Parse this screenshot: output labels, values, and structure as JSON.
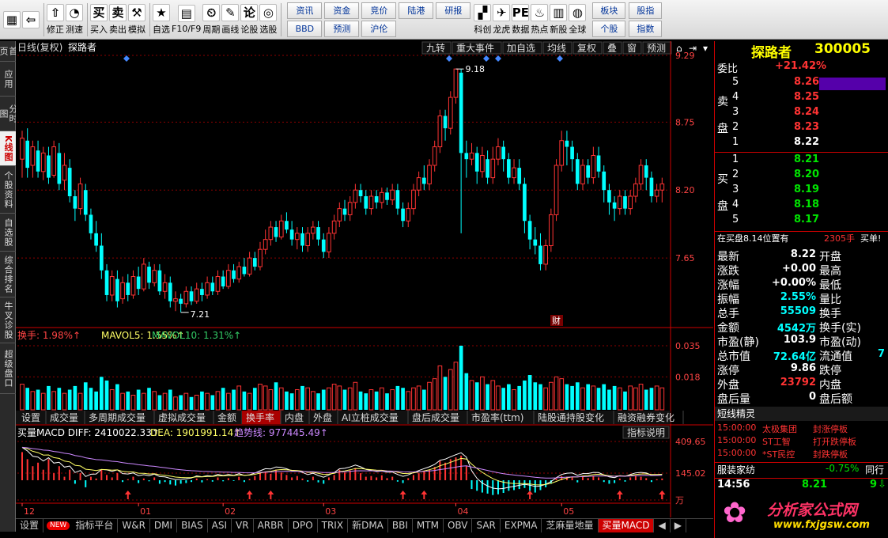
{
  "toolbar": {
    "buttons": [
      {
        "label": "",
        "icon": "win-logo-icon",
        "glyph": "▦"
      },
      {
        "label": "",
        "icon": "back-arrow-icon",
        "glyph": "⇦"
      },
      {
        "label": "修正",
        "icon": "up-arrow-icon",
        "glyph": "⇧"
      },
      {
        "label": "测速",
        "icon": "speed-icon",
        "glyph": "◔"
      },
      {
        "label": "买入",
        "icon": "buy-icon",
        "glyph": "买"
      },
      {
        "label": "卖出",
        "icon": "sell-icon",
        "glyph": "卖"
      },
      {
        "label": "模拟",
        "icon": "hammer-icon",
        "glyph": "⚒"
      },
      {
        "label": "自选",
        "icon": "star-icon",
        "glyph": "★"
      },
      {
        "label": "F10/F9",
        "icon": "f10-icon",
        "glyph": "▤"
      },
      {
        "label": "周期",
        "icon": "period-icon",
        "glyph": "⏲"
      },
      {
        "label": "画线",
        "icon": "pencil-icon",
        "glyph": "✎"
      },
      {
        "label": "论股",
        "icon": "discuss-icon",
        "glyph": "论"
      },
      {
        "label": "选股",
        "icon": "select-icon",
        "glyph": "◎"
      }
    ],
    "grid": [
      "资讯",
      "资金",
      "竞价",
      "陆港",
      "研报",
      "BBD",
      "预测",
      "沪伦"
    ],
    "buttons2": [
      {
        "label": "科创",
        "icon": "star-market-icon",
        "glyph": "▞"
      },
      {
        "label": "龙虎",
        "icon": "dragon-icon",
        "glyph": "✈"
      },
      {
        "label": "数据",
        "icon": "pe-icon",
        "glyph": "PE"
      },
      {
        "label": "热点",
        "icon": "hot-icon",
        "glyph": "♨"
      },
      {
        "label": "新股",
        "icon": "ipo-icon",
        "glyph": "▥"
      },
      {
        "label": "全球",
        "icon": "globe-icon",
        "glyph": "◍"
      }
    ],
    "grid2": [
      "板块",
      "股指",
      "个股",
      "指数"
    ]
  },
  "sidetabs": [
    "首页",
    "应用",
    "分时图",
    "K线图",
    "个股资料",
    "自选股",
    "综合排名",
    "牛叉诊股",
    "超级盘口"
  ],
  "chart_header": {
    "title": "日线(复权)",
    "stock": "探路者"
  },
  "chart_tools": [
    "九转",
    "重大事件",
    "加自选",
    "均线",
    "复权",
    "叠",
    "窗",
    "预测"
  ],
  "price_axis": [
    "9.29",
    "8.75",
    "8.20",
    "7.65"
  ],
  "annotations": {
    "high": "9.18",
    "low": "7.21",
    "cai": "财"
  },
  "vol_header": {
    "a": "换手: 1.98%↑",
    "b": "MAVOL5: 1.55%↑",
    "c": "MAVOL10: 1.31%↑"
  },
  "vol_axis": [
    "0.035",
    "0.018"
  ],
  "vol_tabs": [
    "设置",
    "成交量",
    "多周期成交量",
    "虚拟成交量",
    "金额",
    "换手率",
    "内盘",
    "外盘",
    "AI立桩成交量",
    "盘后成交量",
    "市盈率(ttm)",
    "陆股通持股变化",
    "融资融券变化"
  ],
  "macd_header": {
    "a": "买量MACD DIFF: 2410022.33↑",
    "b": "DEA: 1901991.14↑",
    "c": "趋势线: 977445.49↑",
    "btn": "指标说明"
  },
  "macd_axis": [
    "409.65",
    "145.02",
    "万"
  ],
  "months": [
    "12",
    "01",
    "02",
    "03",
    "04",
    "05"
  ],
  "bottom_tabs": [
    "设置",
    "NEW",
    "指标平台",
    "W&R",
    "DMI",
    "BIAS",
    "ASI",
    "VR",
    "ARBR",
    "DPO",
    "TRIX",
    "新DMA",
    "BBI",
    "MTM",
    "OBV",
    "SAR",
    "EXPMA",
    "芝麻量地量",
    "买量MACD"
  ],
  "quote": {
    "name": "探路者",
    "code": "300005",
    "webi_label": "委比",
    "webi": "+21.42%",
    "sell_label": "卖盘",
    "buy_label": "买盘",
    "asks": [
      {
        "n": "5",
        "p": "8.26"
      },
      {
        "n": "4",
        "p": "8.25"
      },
      {
        "n": "3",
        "p": "8.24"
      },
      {
        "n": "2",
        "p": "8.23"
      },
      {
        "n": "1",
        "p": "8.22"
      }
    ],
    "bids": [
      {
        "n": "1",
        "p": "8.21"
      },
      {
        "n": "2",
        "p": "8.20"
      },
      {
        "n": "3",
        "p": "8.19"
      },
      {
        "n": "4",
        "p": "8.18"
      },
      {
        "n": "5",
        "p": "8.17"
      }
    ],
    "buyline": {
      "a": "在买盘8.14位置有",
      "b": "2305手",
      "c": "买单!"
    },
    "stats": [
      [
        "最新",
        "8.22",
        "开盘",
        ""
      ],
      [
        "涨跌",
        "+0.00",
        "最高",
        ""
      ],
      [
        "涨幅",
        "+0.00%",
        "最低",
        ""
      ],
      [
        "振幅",
        "2.55%",
        "量比",
        ""
      ],
      [
        "总手",
        "55509",
        "换手",
        ""
      ],
      [
        "金额",
        "4542万",
        "换手(实)",
        ""
      ],
      [
        "市盈(静)",
        "103.9",
        "市盈(动)",
        ""
      ],
      [
        "总市值",
        "72.64亿",
        "流通值",
        "7"
      ],
      [
        "涨停",
        "9.86",
        "跌停",
        ""
      ],
      [
        "外盘",
        "23792",
        "内盘",
        ""
      ],
      [
        "盘后量",
        "0",
        "盘后额",
        ""
      ]
    ],
    "short_title": "短线精灵",
    "short": [
      [
        "15:00:00",
        "太极集团",
        "封涨停板"
      ],
      [
        "15:00:00",
        "ST工智",
        "打开跌停板"
      ],
      [
        "15:00:00",
        "*ST民控",
        "封跌停板"
      ]
    ],
    "sector": {
      "name": "服装家纺",
      "chg": "-0.75%",
      "tab": "同行"
    },
    "tick": {
      "time": "14:56",
      "price": "8.21",
      "vol": "9"
    },
    "logo": {
      "a": "分析家公式网",
      "b": "www.fxjgsw.com"
    }
  },
  "colors": {
    "up": "#ff3333",
    "down": "#00ffff",
    "ma5": "#ffffff",
    "ma10": "#ffff00",
    "ma20": "#ff66ff",
    "grid": "#8b0000"
  },
  "chart_data": {
    "type": "candlestick",
    "ylim": [
      7.1,
      9.29
    ],
    "candles": [
      [
        8.45,
        8.62,
        8.68,
        8.3
      ],
      [
        8.6,
        8.38,
        8.7,
        8.3
      ],
      [
        8.4,
        8.55,
        8.6,
        8.3
      ],
      [
        8.52,
        8.35,
        8.6,
        8.3
      ],
      [
        8.35,
        8.5,
        8.55,
        8.28
      ],
      [
        8.48,
        8.3,
        8.55,
        8.25
      ],
      [
        8.32,
        8.55,
        8.6,
        8.3
      ],
      [
        8.5,
        8.25,
        8.58,
        8.2
      ],
      [
        8.28,
        8.4,
        8.5,
        8.2
      ],
      [
        8.38,
        8.15,
        8.45,
        8.1
      ],
      [
        8.15,
        8.05,
        8.2,
        7.95
      ],
      [
        8.05,
        8.25,
        8.3,
        8.0
      ],
      [
        8.2,
        8.0,
        8.25,
        7.95
      ],
      [
        8.0,
        7.85,
        8.05,
        7.8
      ],
      [
        7.85,
        7.75,
        7.95,
        7.7
      ],
      [
        7.75,
        7.55,
        7.85,
        7.48
      ],
      [
        7.55,
        7.35,
        7.6,
        7.3
      ],
      [
        7.35,
        7.5,
        7.55,
        7.3
      ],
      [
        7.48,
        7.3,
        7.55,
        7.25
      ],
      [
        7.32,
        7.45,
        7.5,
        7.28
      ],
      [
        7.45,
        7.35,
        7.52,
        7.3
      ],
      [
        7.35,
        7.5,
        7.55,
        7.32
      ],
      [
        7.5,
        7.4,
        7.58,
        7.35
      ],
      [
        7.4,
        7.6,
        7.65,
        7.38
      ],
      [
        7.58,
        7.45,
        7.62,
        7.4
      ],
      [
        7.45,
        7.55,
        7.6,
        7.42
      ],
      [
        7.55,
        7.38,
        7.6,
        7.35
      ],
      [
        7.38,
        7.45,
        7.52,
        7.32
      ],
      [
        7.45,
        7.3,
        7.5,
        7.25
      ],
      [
        7.3,
        7.32,
        7.38,
        7.22
      ],
      [
        7.32,
        7.28,
        7.36,
        7.21
      ],
      [
        7.28,
        7.38,
        7.42,
        7.25
      ],
      [
        7.38,
        7.3,
        7.42,
        7.27
      ],
      [
        7.3,
        7.4,
        7.45,
        7.28
      ],
      [
        7.4,
        7.35,
        7.45,
        7.3
      ],
      [
        7.35,
        7.45,
        7.5,
        7.32
      ],
      [
        7.45,
        7.38,
        7.5,
        7.35
      ],
      [
        7.38,
        7.5,
        7.55,
        7.35
      ],
      [
        7.5,
        7.42,
        7.55,
        7.4
      ],
      [
        7.42,
        7.55,
        7.6,
        7.4
      ],
      [
        7.55,
        7.48,
        7.6,
        7.45
      ],
      [
        7.48,
        7.58,
        7.62,
        7.45
      ],
      [
        7.58,
        7.52,
        7.65,
        7.5
      ],
      [
        7.52,
        7.65,
        7.7,
        7.5
      ],
      [
        7.65,
        7.58,
        7.7,
        7.55
      ],
      [
        7.58,
        7.72,
        7.78,
        7.55
      ],
      [
        7.72,
        7.8,
        7.88,
        7.68
      ],
      [
        7.8,
        7.9,
        7.95,
        7.75
      ],
      [
        7.9,
        7.82,
        7.95,
        7.78
      ],
      [
        7.82,
        7.95,
        8.0,
        7.8
      ],
      [
        7.95,
        7.88,
        8.02,
        7.85
      ],
      [
        7.88,
        7.8,
        7.95,
        7.75
      ],
      [
        7.8,
        7.85,
        7.9,
        7.72
      ],
      [
        7.85,
        7.75,
        7.9,
        7.7
      ],
      [
        7.75,
        7.85,
        7.9,
        7.7
      ],
      [
        7.85,
        7.9,
        7.95,
        7.8
      ],
      [
        7.9,
        7.8,
        7.95,
        7.75
      ],
      [
        7.8,
        7.7,
        7.85,
        7.65
      ],
      [
        7.7,
        7.85,
        7.9,
        7.65
      ],
      [
        7.85,
        7.95,
        8.0,
        7.8
      ],
      [
        7.95,
        8.05,
        8.1,
        7.9
      ],
      [
        8.05,
        8.0,
        8.12,
        7.95
      ],
      [
        8.0,
        8.1,
        8.15,
        7.95
      ],
      [
        8.1,
        8.2,
        8.25,
        8.05
      ],
      [
        8.2,
        8.15,
        8.25,
        8.1
      ],
      [
        8.15,
        8.05,
        8.2,
        8.0
      ],
      [
        8.05,
        8.15,
        8.2,
        8.0
      ],
      [
        8.15,
        8.1,
        8.2,
        8.05
      ],
      [
        8.1,
        8.18,
        8.22,
        8.05
      ],
      [
        8.18,
        8.12,
        8.22,
        8.08
      ],
      [
        8.12,
        8.2,
        8.25,
        8.08
      ],
      [
        8.2,
        8.05,
        8.25,
        8.0
      ],
      [
        8.05,
        7.95,
        8.1,
        7.9
      ],
      [
        7.95,
        8.05,
        8.1,
        7.9
      ],
      [
        8.05,
        8.2,
        8.25,
        8.0
      ],
      [
        8.2,
        8.3,
        8.35,
        8.15
      ],
      [
        8.3,
        8.25,
        8.4,
        8.2
      ],
      [
        8.25,
        8.4,
        8.45,
        8.2
      ],
      [
        8.4,
        8.55,
        8.6,
        8.35
      ],
      [
        8.55,
        8.8,
        8.85,
        8.5
      ],
      [
        8.8,
        8.7,
        8.85,
        8.6
      ],
      [
        8.7,
        8.95,
        9.0,
        8.65
      ],
      [
        8.95,
        9.18,
        9.18,
        8.9
      ],
      [
        9.15,
        8.5,
        9.18,
        7.85
      ],
      [
        8.5,
        8.45,
        8.6,
        8.3
      ],
      [
        8.45,
        8.5,
        8.58,
        8.4
      ],
      [
        8.5,
        8.35,
        8.55,
        8.25
      ],
      [
        8.35,
        8.48,
        8.55,
        8.3
      ],
      [
        8.45,
        8.3,
        8.52,
        8.25
      ],
      [
        8.3,
        8.45,
        8.55,
        8.25
      ],
      [
        8.45,
        8.55,
        8.62,
        8.4
      ],
      [
        8.55,
        8.45,
        8.6,
        8.35
      ],
      [
        8.45,
        8.3,
        8.5,
        8.25
      ],
      [
        8.3,
        8.38,
        8.45,
        8.25
      ],
      [
        8.38,
        8.25,
        8.45,
        8.2
      ],
      [
        8.25,
        7.95,
        8.3,
        7.85
      ],
      [
        7.95,
        7.8,
        8.0,
        7.72
      ],
      [
        7.8,
        7.75,
        7.9,
        7.68
      ],
      [
        7.75,
        7.6,
        7.85,
        7.55
      ],
      [
        7.6,
        7.75,
        7.8,
        7.55
      ],
      [
        7.75,
        8.0,
        8.05,
        7.7
      ],
      [
        8.0,
        8.4,
        8.45,
        7.95
      ],
      [
        8.4,
        8.6,
        8.68,
        8.35
      ],
      [
        8.6,
        8.55,
        8.68,
        8.4
      ],
      [
        8.55,
        8.45,
        8.6,
        8.35
      ],
      [
        8.45,
        8.25,
        8.5,
        8.2
      ],
      [
        8.25,
        8.4,
        8.45,
        8.2
      ],
      [
        8.4,
        8.3,
        8.45,
        8.25
      ],
      [
        8.3,
        8.48,
        8.55,
        8.25
      ],
      [
        8.48,
        8.35,
        8.55,
        8.3
      ],
      [
        8.35,
        8.2,
        8.4,
        8.1
      ],
      [
        8.2,
        8.1,
        8.25,
        8.0
      ],
      [
        8.1,
        8.05,
        8.15,
        7.95
      ],
      [
        8.05,
        8.15,
        8.2,
        8.0
      ],
      [
        8.15,
        8.05,
        8.2,
        8.0
      ],
      [
        8.05,
        8.15,
        8.2,
        8.0
      ],
      [
        8.15,
        8.25,
        8.3,
        8.1
      ],
      [
        8.25,
        8.4,
        8.45,
        8.2
      ],
      [
        8.4,
        8.3,
        8.45,
        8.2
      ],
      [
        8.3,
        8.15,
        8.35,
        8.1
      ],
      [
        8.15,
        8.2,
        8.25,
        8.1
      ],
      [
        8.2,
        8.25,
        8.3,
        8.1
      ]
    ],
    "volume": [
      0.014,
      0.012,
      0.01,
      0.011,
      0.009,
      0.013,
      0.01,
      0.012,
      0.009,
      0.011,
      0.013,
      0.009,
      0.015,
      0.012,
      0.01,
      0.018,
      0.016,
      0.011,
      0.014,
      0.009,
      0.01,
      0.008,
      0.011,
      0.009,
      0.012,
      0.01,
      0.008,
      0.009,
      0.011,
      0.007,
      0.008,
      0.009,
      0.007,
      0.008,
      0.01,
      0.009,
      0.008,
      0.01,
      0.012,
      0.009,
      0.011,
      0.013,
      0.01,
      0.009,
      0.012,
      0.014,
      0.013,
      0.011,
      0.015,
      0.012,
      0.01,
      0.009,
      0.011,
      0.013,
      0.012,
      0.01,
      0.009,
      0.011,
      0.012,
      0.014,
      0.013,
      0.011,
      0.012,
      0.015,
      0.01,
      0.009,
      0.011,
      0.01,
      0.012,
      0.009,
      0.011,
      0.013,
      0.012,
      0.01,
      0.012,
      0.013,
      0.011,
      0.015,
      0.017,
      0.024,
      0.018,
      0.022,
      0.026,
      0.035,
      0.02,
      0.016,
      0.015,
      0.018,
      0.014,
      0.016,
      0.013,
      0.012,
      0.014,
      0.011,
      0.013,
      0.016,
      0.019,
      0.015,
      0.014,
      0.012,
      0.015,
      0.018,
      0.017,
      0.014,
      0.013,
      0.015,
      0.012,
      0.014,
      0.013,
      0.012,
      0.014,
      0.011,
      0.013,
      0.012,
      0.01,
      0.013,
      0.012,
      0.014,
      0.011,
      0.012,
      0.013,
      0.012
    ],
    "macd_bars": [
      80,
      60,
      40,
      50,
      30,
      60,
      20,
      40,
      10,
      30,
      -10,
      20,
      -20,
      10,
      5,
      30,
      15,
      8,
      20,
      -5,
      3,
      10,
      -8,
      5,
      -3,
      8,
      -10,
      -5,
      -12,
      -15,
      -10,
      -8,
      -5,
      5,
      -6,
      3,
      -4,
      8,
      -3,
      6,
      -2,
      10,
      -5,
      4,
      12,
      20,
      25,
      18,
      30,
      22,
      15,
      8,
      12,
      5,
      -4,
      10,
      -6,
      -10,
      8,
      15,
      30,
      22,
      28,
      35,
      20,
      10,
      12,
      8,
      14,
      6,
      10,
      -4,
      -8,
      6,
      15,
      20,
      25,
      30,
      38,
      55,
      50,
      60,
      65,
      70,
      40,
      -25,
      -30,
      -35,
      -38,
      -42,
      -40,
      -36,
      -30,
      -28,
      -25,
      -22,
      -30,
      -35,
      -28,
      -20,
      -10,
      5,
      12,
      10,
      8,
      -6,
      10,
      6,
      12,
      8,
      -5,
      -10,
      -8,
      5,
      -4,
      8,
      12,
      10,
      6,
      -5,
      3,
      5
    ],
    "xlabels": [
      "12",
      "01",
      "02",
      "03",
      "04",
      "05"
    ]
  }
}
